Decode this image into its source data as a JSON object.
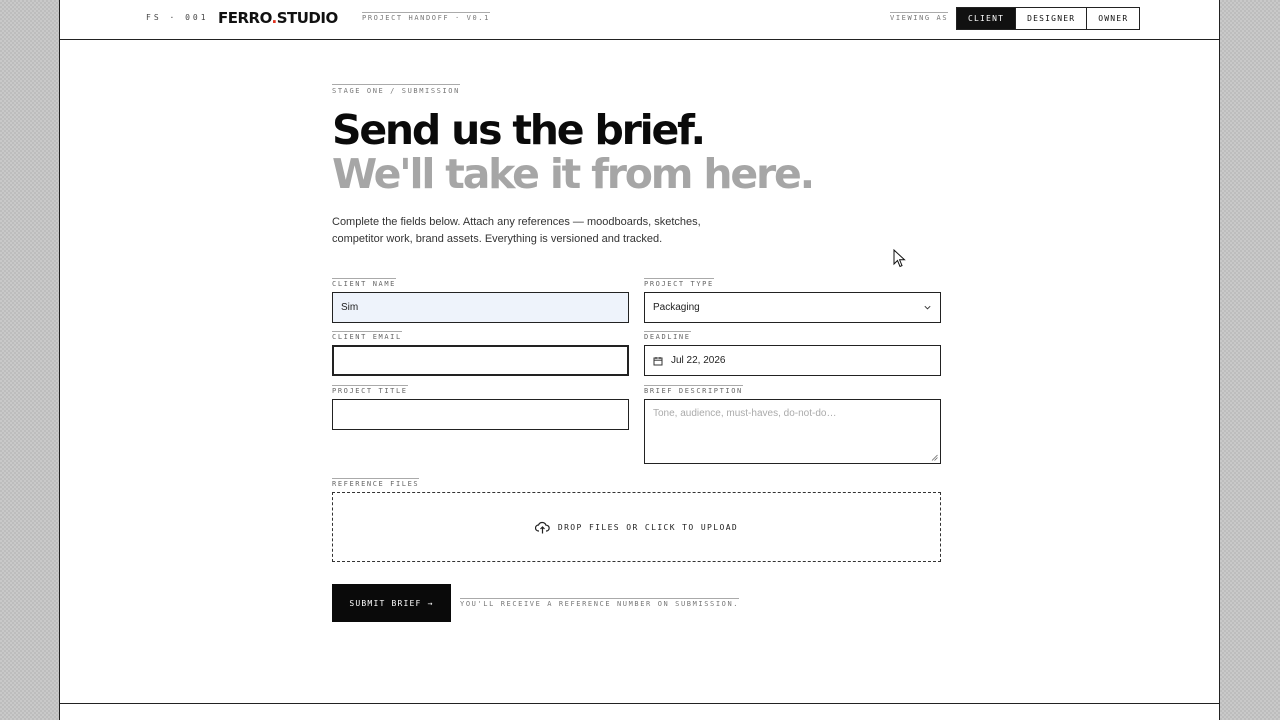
{
  "header": {
    "code": "FS · 001",
    "brand_main": "FERRO",
    "brand_dot": ".",
    "brand_rest": "STUDIO",
    "version": "PROJECT HANDOFF · V0.1",
    "viewing_label": "VIEWING AS",
    "roles": [
      {
        "label": "CLIENT",
        "active": true
      },
      {
        "label": "DESIGNER",
        "active": false
      },
      {
        "label": "OWNER",
        "active": false
      }
    ]
  },
  "hero": {
    "stage": "STAGE ONE / SUBMISSION",
    "title_line1": "Send us the brief.",
    "title_line2": "We'll take it from here.",
    "intro": "Complete the fields below. Attach any references — moodboards, sketches, competitor work, brand assets. Everything is versioned and tracked."
  },
  "form": {
    "client_name": {
      "label": "CLIENT NAME",
      "value": "Sim"
    },
    "project_type": {
      "label": "PROJECT TYPE",
      "value": "Packaging"
    },
    "client_email": {
      "label": "CLIENT EMAIL",
      "value": ""
    },
    "deadline": {
      "label": "DEADLINE",
      "value": "Jul 22, 2026"
    },
    "project_title": {
      "label": "PROJECT TITLE",
      "value": ""
    },
    "brief_description": {
      "label": "BRIEF DESCRIPTION",
      "placeholder": "Tone, audience, must-haves, do-not-do…"
    },
    "reference_files": {
      "label": "REFERENCE FILES",
      "dropzone_text": "DROP FILES OR CLICK TO UPLOAD"
    }
  },
  "submit": {
    "label": "SUBMIT BRIEF →",
    "hint": "YOU'LL RECEIVE A REFERENCE NUMBER ON SUBMISSION."
  },
  "colors": {
    "accent": "#e0301e",
    "ink": "#0a0a0a",
    "muted_heading": "#a6a6a6",
    "focus_fill": "#eef3fb"
  }
}
